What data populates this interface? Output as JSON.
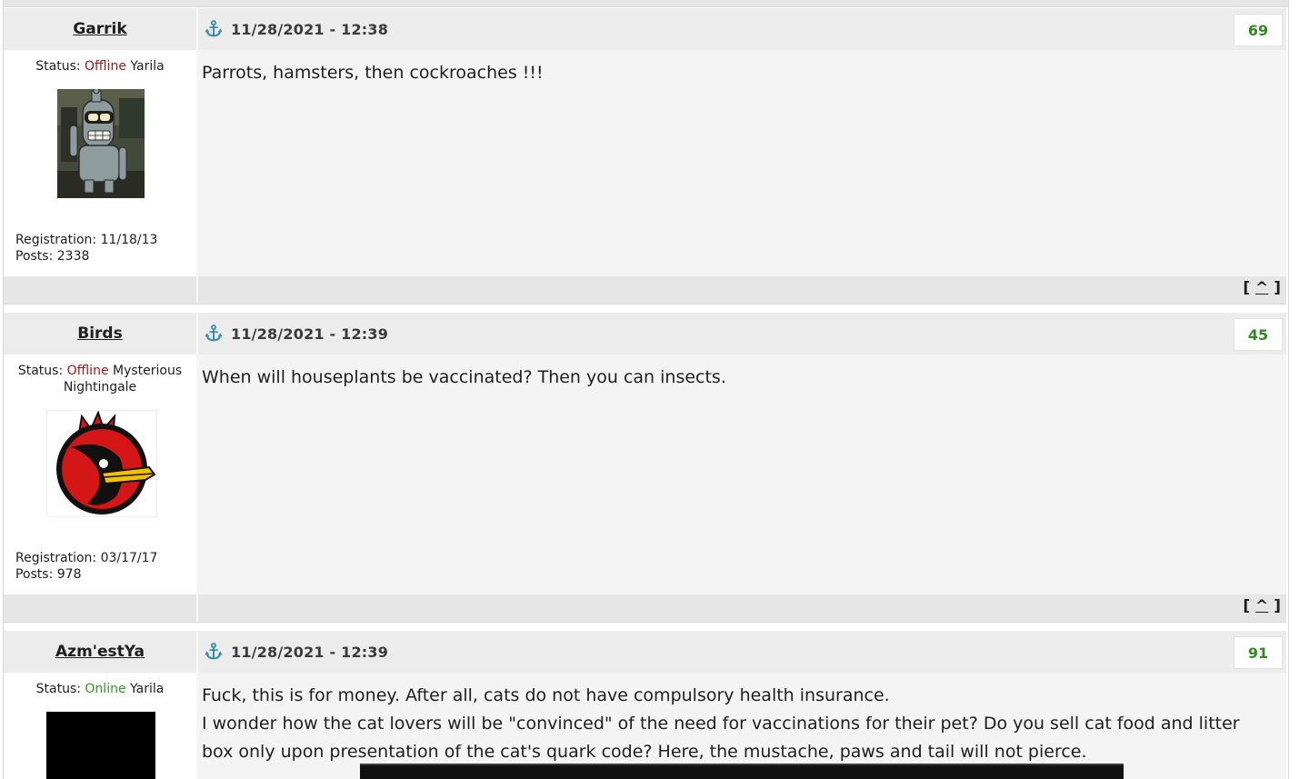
{
  "posts": [
    {
      "author": "Garrik",
      "date": "11/28/2021 - 12:38",
      "rating": "69",
      "status_label": "Status:",
      "status_state": "Offline",
      "status_rank": "Yarila",
      "registration": "Registration: 11/18/13",
      "posts_count": "Posts: 2338",
      "text": "Parrots, hamsters, then cockroaches !!!",
      "to_top": "^"
    },
    {
      "author": "Birds",
      "date": "11/28/2021 - 12:39",
      "rating": "45",
      "status_label": "Status:",
      "status_state": "Offline",
      "status_rank": "Mysterious Nightingale",
      "registration": "Registration: 03/17/17",
      "posts_count": "Posts: 978",
      "text": "When will houseplants be vaccinated? Then you can insects.",
      "to_top": "^"
    },
    {
      "author": "Azm'estYa",
      "date": "11/28/2021 - 12:39",
      "rating": "91",
      "status_label": "Status:",
      "status_state": "Online",
      "status_rank": "Yarila",
      "text_lines": [
        "Fuck, this is for money. After all, cats do not have compulsory health insurance.",
        "I wonder how the cat lovers will be \"convinced\" of the need for vaccinations for their pet? Do you sell cat food and litter box only upon presentation of the cat's quark code? Here, the mustache, paws and tail will not pierce."
      ]
    }
  ],
  "colors": {
    "rating": "#2e8b1e",
    "offline": "#a01818",
    "online": "#2e9a1e",
    "anchor": "#3a8fa8"
  },
  "icons": [
    "anchor-icon"
  ]
}
